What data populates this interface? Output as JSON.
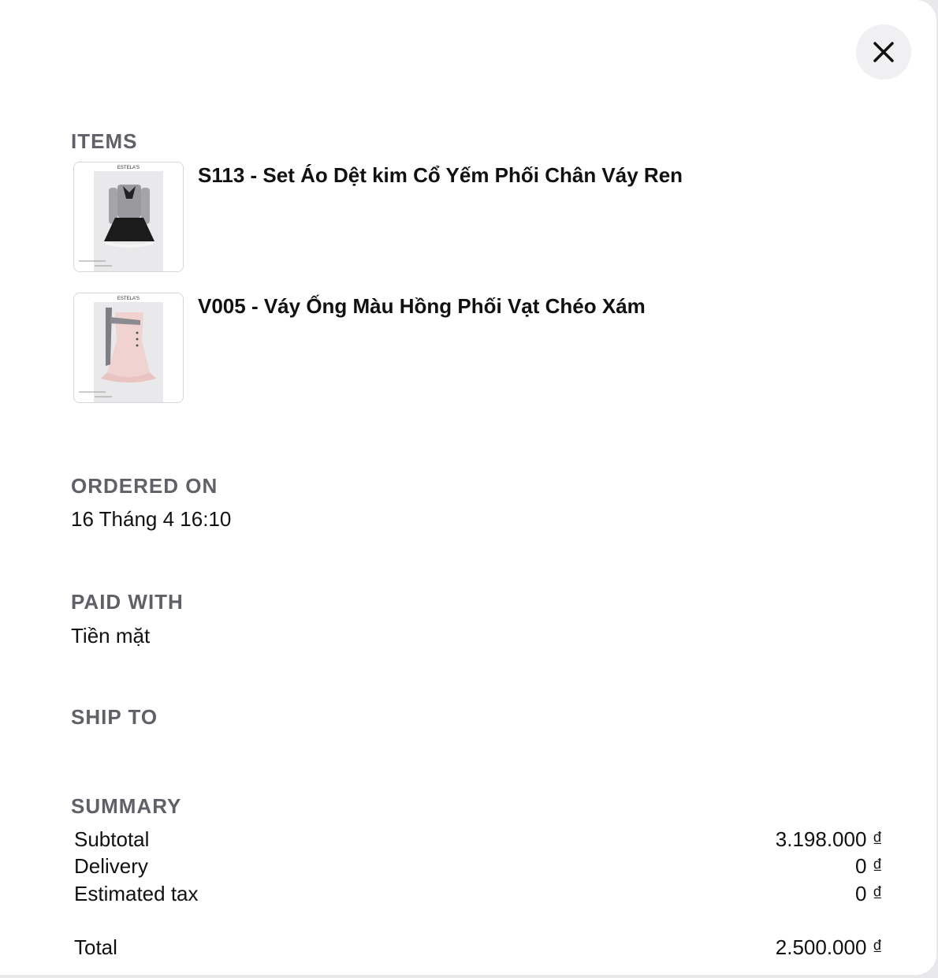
{
  "close": {
    "icon": "close-icon"
  },
  "items": {
    "heading": "ITEMS",
    "list": [
      {
        "name": "S113 - Set Áo Dệt kim Cổ Yếm Phối Chân Váy Ren",
        "brand": "ESTELA'S"
      },
      {
        "name": "V005 - Váy Ống Màu Hồng Phối Vạt Chéo Xám",
        "brand": "ESTELA'S"
      }
    ]
  },
  "ordered_on": {
    "heading": "ORDERED ON",
    "value": "16 Tháng 4 16:10"
  },
  "paid_with": {
    "heading": "PAID WITH",
    "value": "Tiền mặt"
  },
  "ship_to": {
    "heading": "SHIP TO"
  },
  "summary": {
    "heading": "SUMMARY",
    "subtotal_label": "Subtotal",
    "subtotal_value": "3.198.000 ₫",
    "delivery_label": "Delivery",
    "delivery_value": "0 ₫",
    "tax_label": "Estimated tax",
    "tax_value": "0 ₫",
    "total_label": "Total",
    "total_value": "2.500.000 ₫"
  }
}
